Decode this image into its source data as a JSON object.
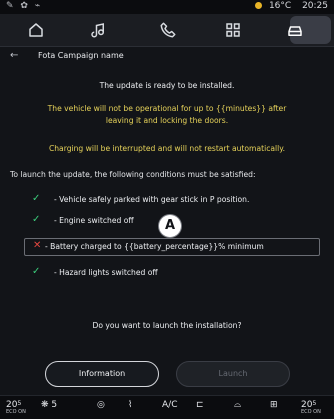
{
  "status_bar": {
    "left": "✎ ✿ ⌁",
    "temperature": "16°C",
    "time": "20:25"
  },
  "top_nav": {
    "items": [
      {
        "icon": "home-icon"
      },
      {
        "icon": "music-icon"
      },
      {
        "icon": "phone-icon"
      },
      {
        "icon": "apps-grid-icon"
      },
      {
        "icon": "car-icon",
        "active": true
      }
    ]
  },
  "header": {
    "back_label": "←",
    "title": "Fota Campaign name"
  },
  "body": {
    "ready": "The update is ready to be installed.",
    "warning1_line1": "The vehicle will not be operational for up to {{minutes}} after",
    "warning1_line2": "leaving it and locking the doors.",
    "warning2": "Charging will be interrupted and will not restart automatically.",
    "conditions_title": "To launch the update, the following conditions must be satisfied:",
    "conditions": [
      {
        "status": "ok",
        "label": "- Vehicle safely parked with gear stick in P position."
      },
      {
        "status": "ok",
        "label": "- Engine switched off"
      },
      {
        "status": "fail",
        "label": "- Battery charged to {{battery_percentage}}% minimum"
      },
      {
        "status": "ok",
        "label": "- Hazard lights switched off"
      }
    ],
    "callout": "A",
    "question": "Do you want to launch the installation?",
    "buttons": {
      "information": "Information",
      "launch": "Launch"
    }
  },
  "bottom_bar": {
    "left_temp": "20",
    "left_temp_small": "ECO ON",
    "fan": "5",
    "ac": "A/C",
    "right_temp": "20",
    "right_temp_small": "ECO ON",
    "icons": [
      "fan-icon",
      "defrost-icon",
      "seat-heat-icon",
      "seat-icon",
      "windshield-icon",
      "rear-defrost-icon"
    ]
  },
  "colors": {
    "accent_yellow": "#e7d35a",
    "ok_green": "#3bcc7b",
    "fail_red": "#e2473f",
    "active_tab": "#3a3d46"
  }
}
